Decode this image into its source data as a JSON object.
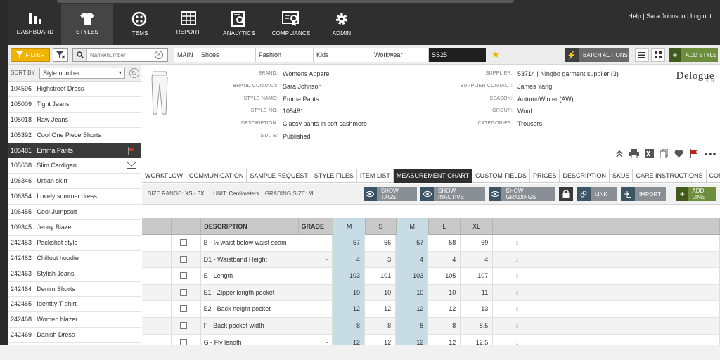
{
  "nav": {
    "items": [
      {
        "label": "DASHBOARD",
        "icon": "bar-chart-icon"
      },
      {
        "label": "STYLES",
        "icon": "shirt-icon"
      },
      {
        "label": "ITEMS",
        "icon": "button-icon"
      },
      {
        "label": "REPORT",
        "icon": "table-icon"
      },
      {
        "label": "ANALYTICS",
        "icon": "analytics-icon"
      },
      {
        "label": "COMPLIANCE",
        "icon": "certificate-icon"
      },
      {
        "label": "ADMIN",
        "icon": "gear-icon"
      }
    ],
    "active": "STYLES",
    "links": "Help | Sara Johnson | Log out"
  },
  "toolbar": {
    "filter_label": "FILTER",
    "search_placeholder": "Name/number",
    "tabs": [
      "MAIN",
      "Shoes",
      "Fashion",
      "Kids",
      "Workwear",
      "SS25"
    ],
    "active_tab": "SS25",
    "batch_label": "BATCH ACTIONS",
    "add_style_label": "ADD STYLE"
  },
  "sidebar": {
    "sort_label": "SORT BY",
    "sort_value": "Style number",
    "items": [
      {
        "text": "104596 | Highstreet Dress"
      },
      {
        "text": "105009 | Tight Jeans"
      },
      {
        "text": "105018 | Raw Jeans"
      },
      {
        "text": "105392 | Cool One Piece Shorts"
      },
      {
        "text": "105481 | Emma Pants",
        "selected": true,
        "icon": "flag-icon"
      },
      {
        "text": "105638 | Slim Cardigan",
        "icon": "mail-icon"
      },
      {
        "text": "106346 | Urban skirt"
      },
      {
        "text": "106354 | Lovely summer dress"
      },
      {
        "text": "106455 | Cool Jumpsuit"
      },
      {
        "text": "109345 | Jenny Blazer"
      },
      {
        "text": "242453 | Packshot style"
      },
      {
        "text": "242462 | Chillout hoodie"
      },
      {
        "text": "242463 | Stylish Jeans"
      },
      {
        "text": "242464 | Denim Shorts"
      },
      {
        "text": "242465 | Identity T-shirt"
      },
      {
        "text": "242468 | Women blazer"
      },
      {
        "text": "242469 | Danish Dress"
      }
    ]
  },
  "style": {
    "left": [
      {
        "label": "BRAND:",
        "value": "Womens Apparel"
      },
      {
        "label": "BRAND CONTACT:",
        "value": "Sara Johnson"
      },
      {
        "label": "STYLE NAME:",
        "value": "Emma Pants"
      },
      {
        "label": "STYLE NO:",
        "value": "105481"
      },
      {
        "label": "DESCRIPTION:",
        "value": "Classy pants in soft cashmere"
      },
      {
        "label": "STATE:",
        "value": "Published"
      }
    ],
    "right": [
      {
        "label": "SUPPLIER:",
        "value": "53714 | Ningbo garment supplier (3)"
      },
      {
        "label": "SUPPLIER CONTACT:",
        "value": "James Yang"
      },
      {
        "label": "SEASON:",
        "value": "AutumnWinter (AW)"
      },
      {
        "label": "GROUP:",
        "value": "Wool"
      },
      {
        "label": "CATEGORIES:",
        "value": "Trousers"
      }
    ],
    "logo": "Delogue",
    "logo_sub": "PLM"
  },
  "tabs": [
    "WORKFLOW",
    "COMMUNICATION",
    "SAMPLE REQUEST",
    "STYLE FILES",
    "ITEM LIST",
    "MEASUREMENT CHART",
    "CUSTOM FIELDS",
    "PRICES",
    "DESCRIPTION",
    "SKUS",
    "CARE INSTRUCTIONS",
    "COMPLIANCE"
  ],
  "active_tab": "MEASUREMENT CHART",
  "chart_info": {
    "size_range_label": "SIZE RANGE:",
    "size_range": "XS - 3XL",
    "unit_label": "UNIT:",
    "unit": "Centimeters",
    "grading_label": "GRADING SIZE:",
    "grading": "M"
  },
  "actions": {
    "show_tags": "SHOW TAGS",
    "show_inactive": "SHOW INACTIVE",
    "show_gradings": "SHOW GRADINGS",
    "link": "LINK",
    "import": "IMPORT",
    "add_line": "ADD LINE"
  },
  "table": {
    "headers": [
      "",
      "",
      "DESCRIPTION",
      "GRADE",
      "M",
      "S",
      "M",
      "L",
      "XL",
      ""
    ],
    "rows": [
      {
        "desc": "B - ½ waist below waist seam",
        "grade": "-",
        "m": "57",
        "s": "56",
        "m2": "57",
        "l": "58",
        "xl": "59"
      },
      {
        "desc": "D1 - Waistband Height",
        "grade": "-",
        "m": "4",
        "s": "3",
        "m2": "4",
        "l": "4",
        "xl": "4"
      },
      {
        "desc": "E - Length",
        "grade": "-",
        "m": "103",
        "s": "101",
        "m2": "103",
        "l": "105",
        "xl": "107"
      },
      {
        "desc": "E1 - Zipper length pocket",
        "grade": "-",
        "m": "10",
        "s": "10",
        "m2": "10",
        "l": "10",
        "xl": "11"
      },
      {
        "desc": "E2 - Back height pocket",
        "grade": "-",
        "m": "12",
        "s": "12",
        "m2": "12",
        "l": "12",
        "xl": "13"
      },
      {
        "desc": "F - Back pocket width",
        "grade": "-",
        "m": "8",
        "s": "8",
        "m2": "8",
        "l": "8",
        "xl": "8.5"
      },
      {
        "desc": "G - Fly length",
        "grade": "-",
        "m": "12",
        "s": "12",
        "m2": "12",
        "l": "12",
        "xl": "12.5"
      }
    ]
  }
}
